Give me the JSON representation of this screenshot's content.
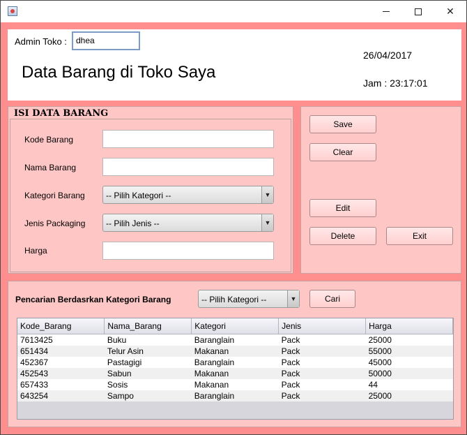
{
  "window": {
    "icons": {
      "app": "java-app-icon",
      "min": "minimize-icon",
      "max": "maximize-icon",
      "close": "close-icon"
    },
    "close_glyph": "✕"
  },
  "header": {
    "admin_label": "Admin Toko :",
    "admin_value": "dhea",
    "title": "Data Barang di Toko Saya",
    "date": "26/04/2017",
    "time": "Jam : 23:17:01"
  },
  "form": {
    "title": "ISI DATA BARANG",
    "kode_label": "Kode Barang",
    "kode_value": "",
    "nama_label": "Nama Barang",
    "nama_value": "",
    "kategori_label": "Kategori Barang",
    "kategori_selected": "-- Pilih Kategori --",
    "jenis_label": "Jenis Packaging",
    "jenis_selected": "-- Pilih Jenis --",
    "harga_label": "Harga",
    "harga_value": ""
  },
  "buttons": {
    "save": "Save",
    "clear": "Clear",
    "edit": "Edit",
    "delete": "Delete",
    "exit": "Exit"
  },
  "search": {
    "label": "Pencarian Berdasrkan Kategori Barang",
    "kategori_selected": "-- Pilih Kategori --",
    "cari": "Cari"
  },
  "table": {
    "columns": [
      "Kode_Barang",
      "Nama_Barang",
      "Kategori",
      "Jenis",
      "Harga"
    ],
    "rows": [
      [
        "7613425",
        "Buku",
        "Baranglain",
        "Pack",
        "25000"
      ],
      [
        "651434",
        "Telur Asin",
        "Makanan",
        "Pack",
        "55000"
      ],
      [
        "452367",
        "Pastagigi",
        "Baranglain",
        "Pack",
        "45000"
      ],
      [
        "452543",
        "Sabun",
        "Makanan",
        "Pack",
        "50000"
      ],
      [
        "657433",
        "Sosis",
        "Makanan",
        "Pack",
        "44"
      ],
      [
        "643254",
        "Sampo",
        "Baranglain",
        "Pack",
        "25000"
      ]
    ]
  },
  "colors": {
    "window_bg": "#ff8f8f",
    "panel_bg": "#ffc6c6"
  }
}
